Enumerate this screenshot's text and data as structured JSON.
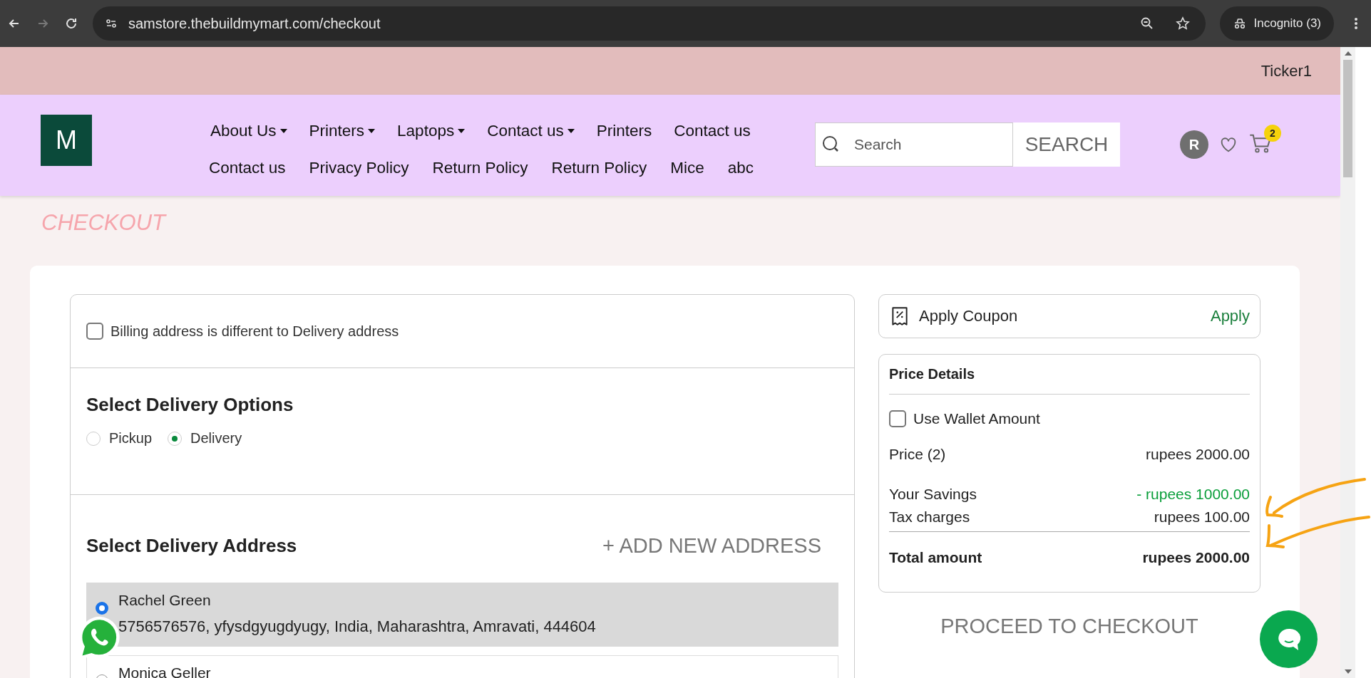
{
  "browser": {
    "url": "samstore.thebuildmymart.com/checkout",
    "profile": "Incognito (3)"
  },
  "ticker": "Ticker1",
  "header": {
    "logo": "M",
    "nav_rows": [
      [
        {
          "label": "About Us",
          "dropdown": true
        },
        {
          "label": "Printers",
          "dropdown": true
        },
        {
          "label": "Laptops",
          "dropdown": true
        },
        {
          "label": "Contact us",
          "dropdown": true
        },
        {
          "label": "Printers",
          "dropdown": false
        },
        {
          "label": "Contact us",
          "dropdown": false
        }
      ],
      [
        {
          "label": "Contact us",
          "dropdown": false
        },
        {
          "label": "Privacy Policy",
          "dropdown": false
        },
        {
          "label": "Return Policy",
          "dropdown": false
        },
        {
          "label": "Return Policy",
          "dropdown": false
        },
        {
          "label": "Mice",
          "dropdown": false
        },
        {
          "label": "abc",
          "dropdown": false
        }
      ]
    ],
    "search": {
      "placeholder": "Search",
      "button": "SEARCH"
    },
    "avatar": "R",
    "cart_count": "2"
  },
  "page_title": "CHECKOUT",
  "billing": {
    "label": "Billing address is different to Delivery address",
    "checked": false
  },
  "delivery_options": {
    "title": "Select Delivery Options",
    "options": [
      {
        "label": "Pickup",
        "selected": false
      },
      {
        "label": "Delivery",
        "selected": true
      }
    ]
  },
  "delivery_address": {
    "title": "Select Delivery Address",
    "add_button": "+ ADD NEW ADDRESS",
    "addresses": [
      {
        "name": "Rachel Green",
        "details": "5756576576, yfysdgyugdyugy, India, Maharashtra, Amravati, 444604",
        "selected": true
      },
      {
        "name": "Monica Geller",
        "selected": false
      }
    ]
  },
  "coupon": {
    "label": "Apply Coupon",
    "action": "Apply"
  },
  "price_details": {
    "title": "Price Details",
    "wallet": {
      "label": "Use Wallet Amount",
      "checked": false
    },
    "rows": [
      {
        "kind": "normal",
        "label": "Price (2)",
        "value": "rupees 2000.00"
      },
      {
        "kind": "savings",
        "label": "Your Savings",
        "value": "- rupees 1000.00"
      },
      {
        "kind": "tax",
        "label": "Tax charges",
        "value": "rupees 100.00"
      },
      {
        "kind": "total",
        "label": "Total amount",
        "value": "rupees 2000.00"
      }
    ]
  },
  "proceed_button": "PROCEED TO CHECKOUT"
}
